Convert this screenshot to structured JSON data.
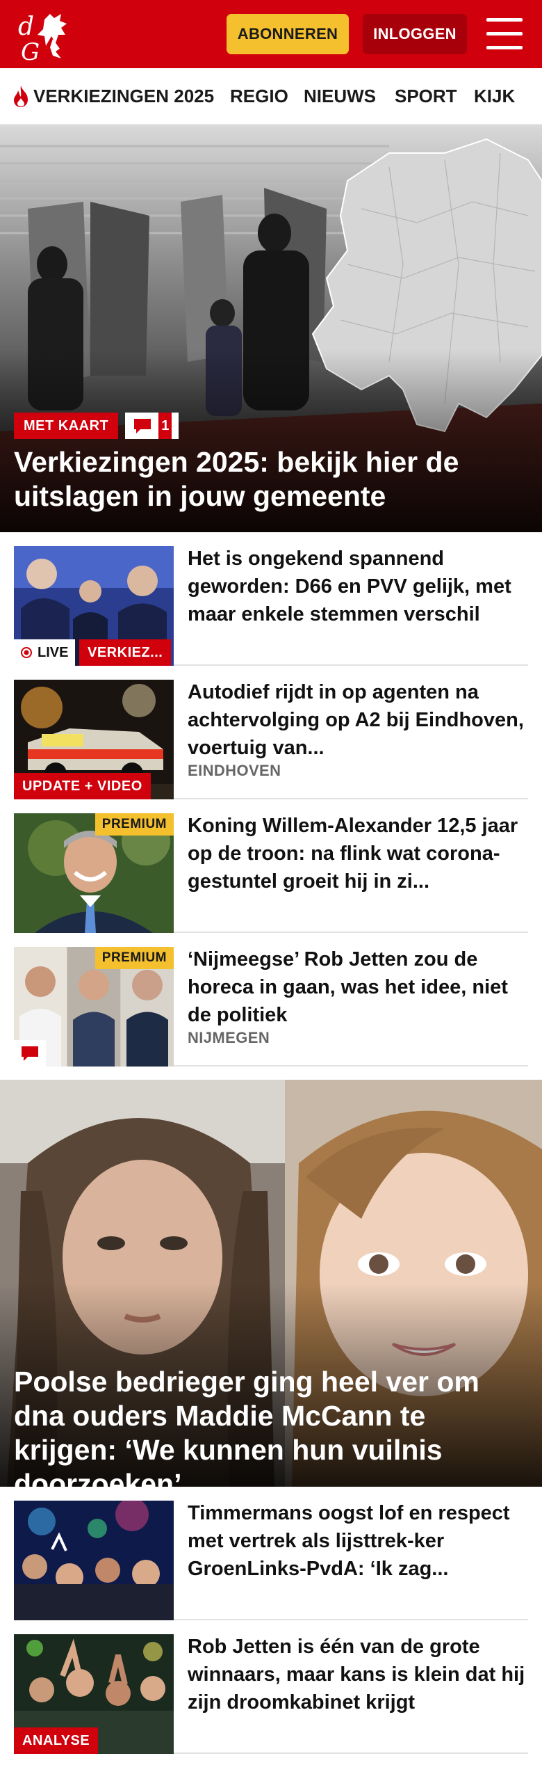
{
  "header": {
    "logo_text": "dG",
    "subscribe_label": "ABONNEREN",
    "login_label": "INLOGGEN"
  },
  "nav": {
    "items": [
      {
        "label": "VERKIEZINGEN 2025",
        "icon": "flame-icon"
      },
      {
        "label": "REGIO"
      },
      {
        "label": "NIEUWS"
      },
      {
        "label": "SPORT"
      },
      {
        "label": "KIJK"
      }
    ]
  },
  "hero": {
    "tag": "MET KAART",
    "comment_count": "1",
    "title": "Verkiezingen 2025: bekijk hier de uitslagen in jouw gemeente"
  },
  "articles": [
    {
      "title": "Het is ongekend spannend geworden: D66 en PVV gelijk, met maar enkele stemmen verschil",
      "live_label": "LIVE",
      "tag": "VERKIEZ..."
    },
    {
      "title": "Autodief rijdt in op agenten na achtervolging op A2 bij Eindhoven, voertuig van...",
      "tag": "UPDATE + VIDEO",
      "meta": "EINDHOVEN"
    },
    {
      "title": "Koning Willem-Alexander 12,5 jaar op de troon: na flink wat corona-gestuntel groeit hij in zi...",
      "premium": "PREMIUM"
    },
    {
      "title": "‘Nijmeegse’ Rob Jetten zou de horeca in gaan, was het idee, niet de politiek",
      "premium": "PREMIUM",
      "meta": "NIJMEGEN"
    }
  ],
  "big_story": {
    "title": "Poolse bedrieger ging heel ver om dna ouders Maddie McCann te krijgen: ‘We kunnen hun vuilnis doorzoeken’"
  },
  "articles2": [
    {
      "title": "Timmermans oogst lof en respect met vertrek als lijsttrek-ker GroenLinks-PvdA: ‘Ik zag..."
    },
    {
      "title": "Rob Jetten is één van de grote winnaars, maar kans is klein dat hij zijn droomkabinet krijgt",
      "tag": "ANALYSE"
    }
  ],
  "colors": {
    "brand_red": "#d0000c",
    "dark_red": "#a8000a",
    "yellow": "#f5c02d"
  }
}
